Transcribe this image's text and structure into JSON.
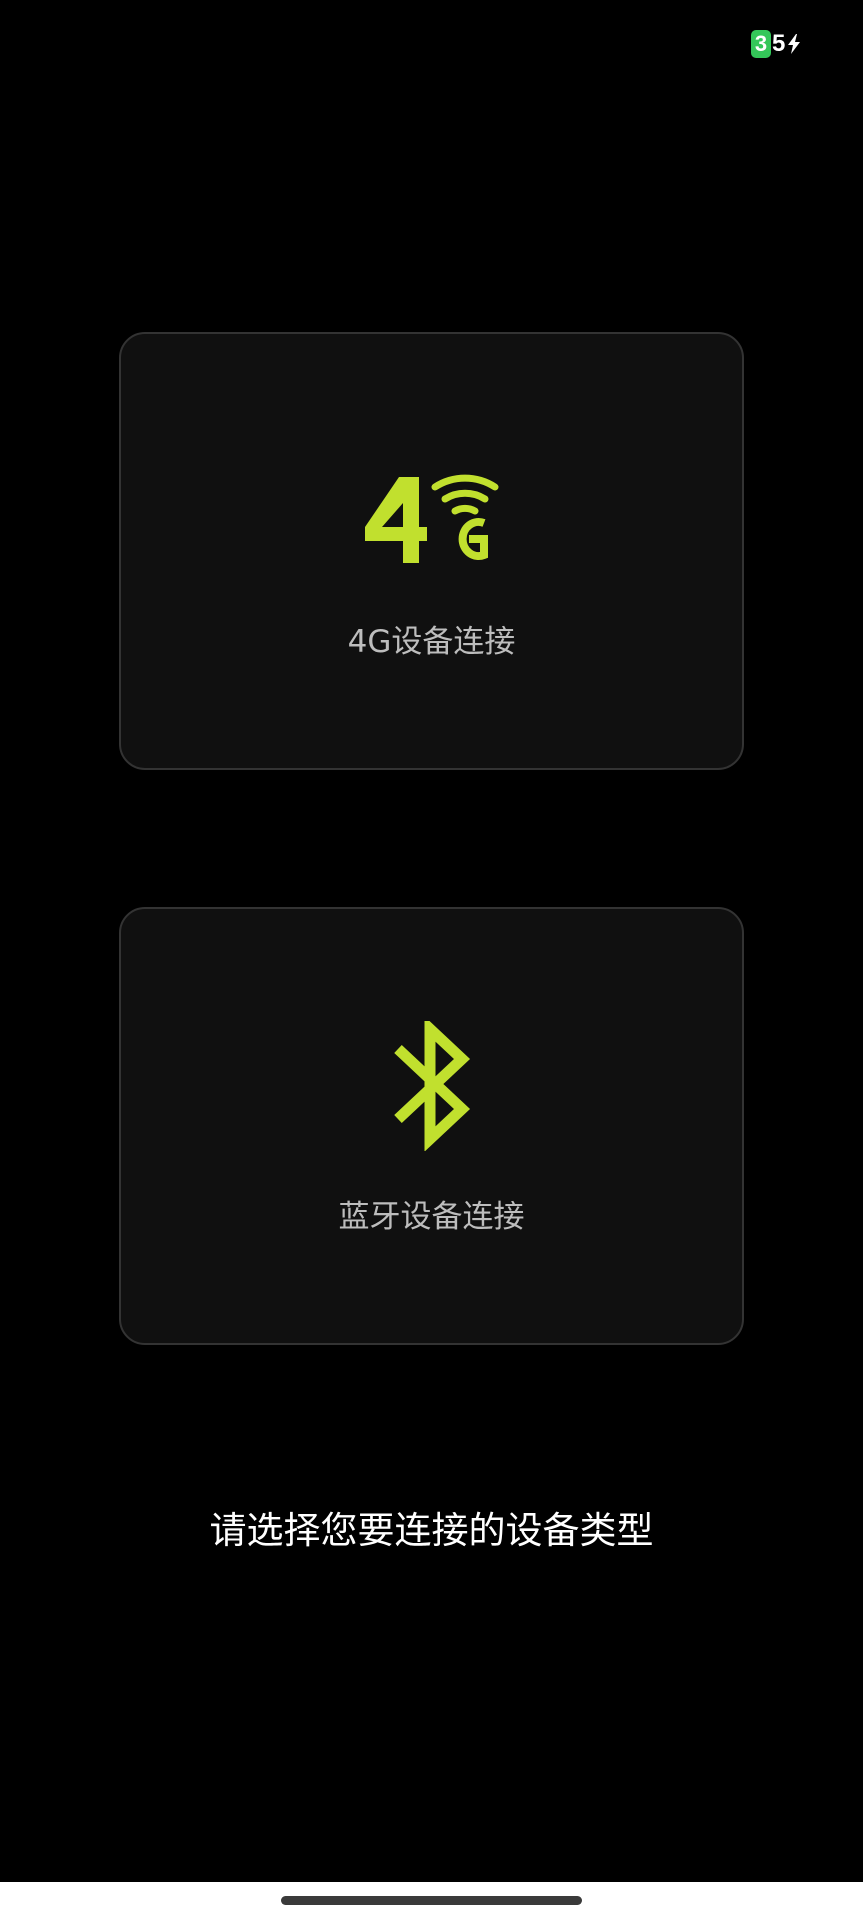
{
  "status_bar": {
    "battery_level_first": "3",
    "battery_level_rest": "5",
    "charging_icon": "bolt-icon"
  },
  "colors": {
    "accent": "#c1e02e",
    "background": "#000000",
    "card_background": "#101010",
    "card_border": "#333333",
    "label_text": "#bdbdbd",
    "battery_green": "#34c759"
  },
  "options": [
    {
      "icon": "4g-signal-icon",
      "label": "4G设备连接"
    },
    {
      "icon": "bluetooth-icon",
      "label": "蓝牙设备连接"
    }
  ],
  "prompt": "请选择您要连接的设备类型"
}
